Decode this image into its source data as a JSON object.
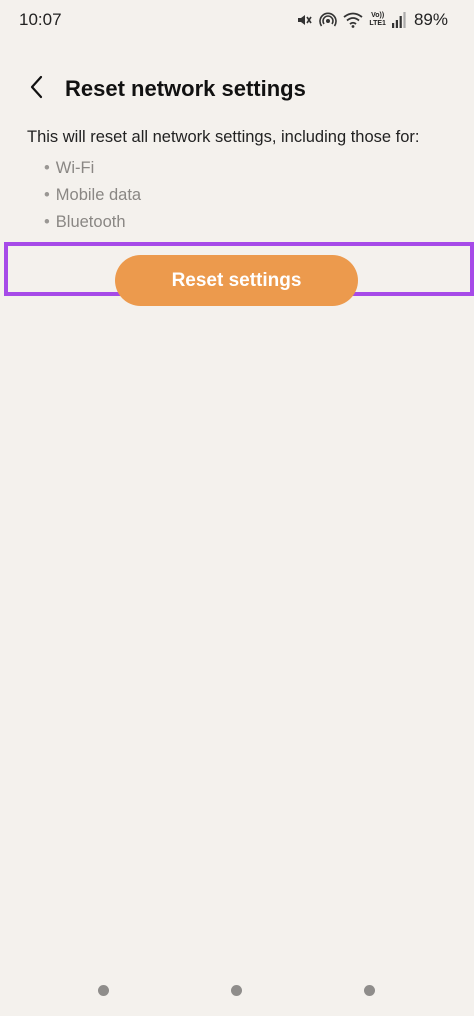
{
  "status_bar": {
    "time": "10:07",
    "lte_label_top": "Vo))",
    "lte_label_bottom": "LTE1",
    "battery": "89%",
    "icons": [
      "mute-icon",
      "hotspot-icon",
      "wifi-icon",
      "lte-icon",
      "signal-icon"
    ]
  },
  "header": {
    "title": "Reset network settings",
    "back_icon": "chevron-left-icon"
  },
  "main": {
    "description": "This will reset all network settings, including those for:",
    "bullet_glyph": "•",
    "items": [
      {
        "label": "Wi-Fi"
      },
      {
        "label": "Mobile data"
      },
      {
        "label": "Bluetooth"
      }
    ],
    "reset_button_label": "Reset settings"
  },
  "colors": {
    "background": "#f4f1ed",
    "button": "#ec9a4d",
    "highlight": "#a64ae8"
  },
  "nav_bar": {
    "items": [
      "recent-apps-button",
      "home-button",
      "back-nav-button"
    ]
  }
}
